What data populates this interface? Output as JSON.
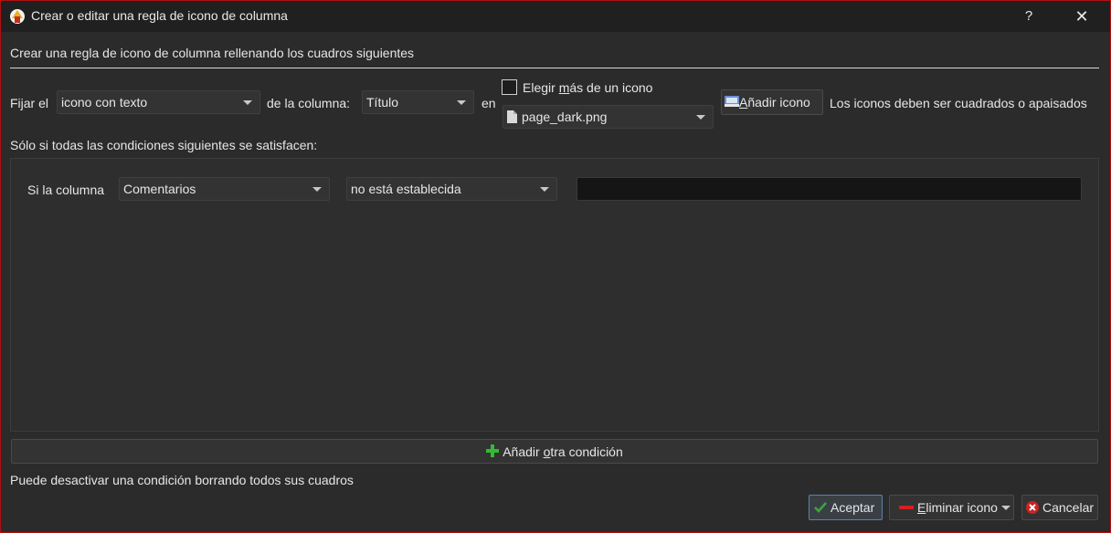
{
  "window": {
    "title": "Crear o editar una regla de icono de columna",
    "help_label": "?",
    "close_label": "✕"
  },
  "heading": "Crear una regla de icono de columna rellenando los cuadros siguientes",
  "rule": {
    "set_label": "Fijar el",
    "kind_value": "icono con texto",
    "column_label": "de la columna:",
    "column_value": "Título",
    "in_label": "en",
    "multi_pre": "Elegir ",
    "multi_underlined": "m",
    "multi_post": "ás de un icono",
    "multi_checked": false,
    "icon_value": "page_dark.png",
    "add_icon_underlined": "A",
    "add_icon_rest": "ñadir icono",
    "icons_note": "Los iconos deben ser cuadrados o apaisados"
  },
  "conditions_heading": "Sólo si todas las condiciones siguientes se satisfacen:",
  "condition": {
    "if_label": "Si la columna",
    "column_value": "Comentarios",
    "op_value": "no está establecida",
    "value": ""
  },
  "add_condition": {
    "pre": "Añadir ",
    "underlined": "o",
    "post": "tra condición"
  },
  "footer_note": "Puede desactivar una condición borrando todos sus cuadros",
  "buttons": {
    "accept": "Aceptar",
    "remove_underlined": "E",
    "remove_rest": "liminar icono",
    "cancel": "Cancelar"
  },
  "colors": {
    "accept_icon": "#3aa83a",
    "remove_icon": "#d42020",
    "cancel_icon": "#cc2222",
    "add_condition_icon": "#33bb33",
    "window_border": "#b01010"
  }
}
